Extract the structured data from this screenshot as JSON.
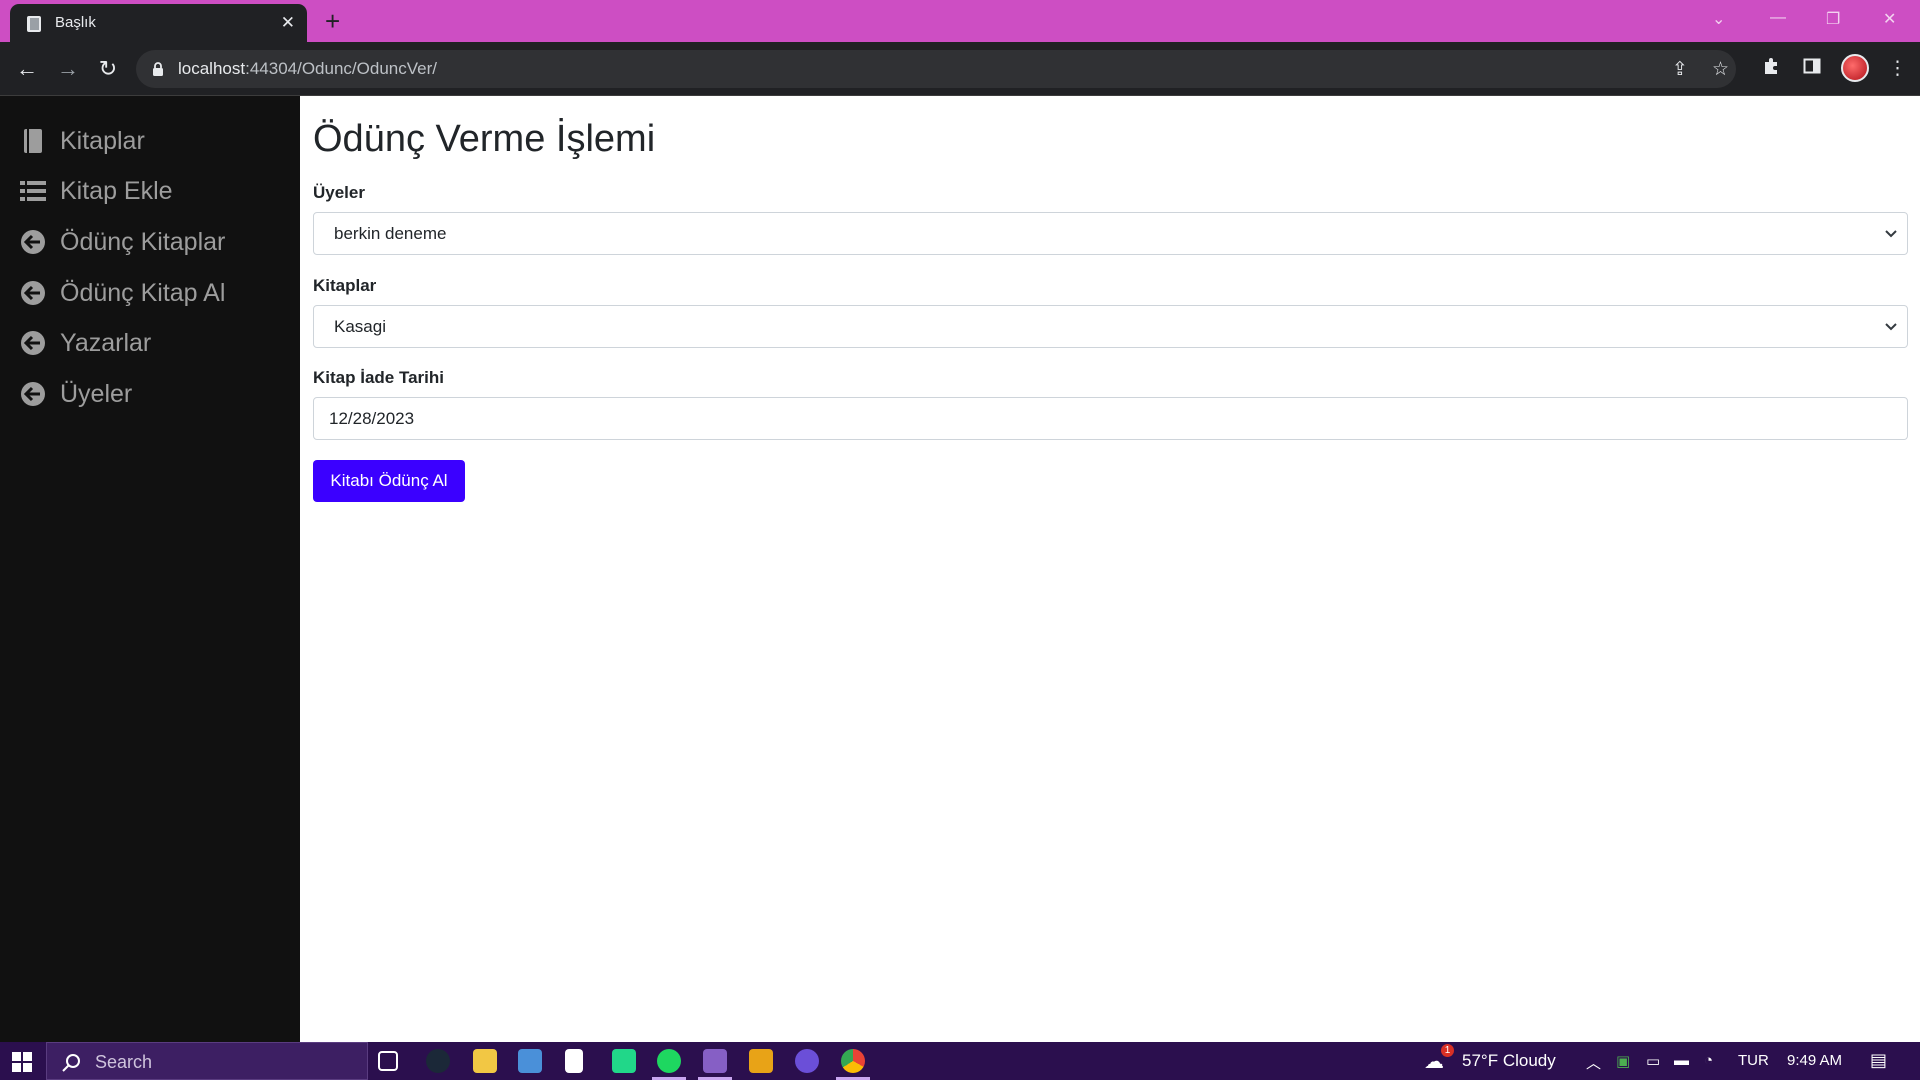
{
  "browser": {
    "tab_title": "Başlık",
    "url_host": "localhost",
    "url_rest": ":44304/Odunc/OduncVer/"
  },
  "sidebar": {
    "items": [
      {
        "label": "Kitaplar",
        "icon": "book-icon"
      },
      {
        "label": "Kitap Ekle",
        "icon": "list-icon"
      },
      {
        "label": "Ödünç Kitaplar",
        "icon": "arrow-circle-left-icon"
      },
      {
        "label": "Ödünç Kitap Al",
        "icon": "arrow-circle-left-icon"
      },
      {
        "label": "Yazarlar",
        "icon": "arrow-circle-left-icon"
      },
      {
        "label": "Üyeler",
        "icon": "arrow-circle-left-icon"
      }
    ]
  },
  "form": {
    "title": "Ödünç Verme İşlemi",
    "members_label": "Üyeler",
    "members_value": "berkin deneme",
    "books_label": "Kitaplar",
    "books_value": "Kasagi",
    "return_date_label": "Kitap İade Tarihi",
    "return_date_value": "12/28/2023",
    "submit_label": "Kitabı Ödünç Al"
  },
  "taskbar": {
    "search_placeholder": "Search",
    "weather": "57°F  Cloudy",
    "weather_badge": "1",
    "language": "TUR",
    "time": "9:49 AM"
  },
  "colors": {
    "tab_strip": "#cd4ec3",
    "sidebar_bg": "#111111",
    "primary_button": "#3b00ff",
    "taskbar_bg": "#2b0f4e"
  }
}
